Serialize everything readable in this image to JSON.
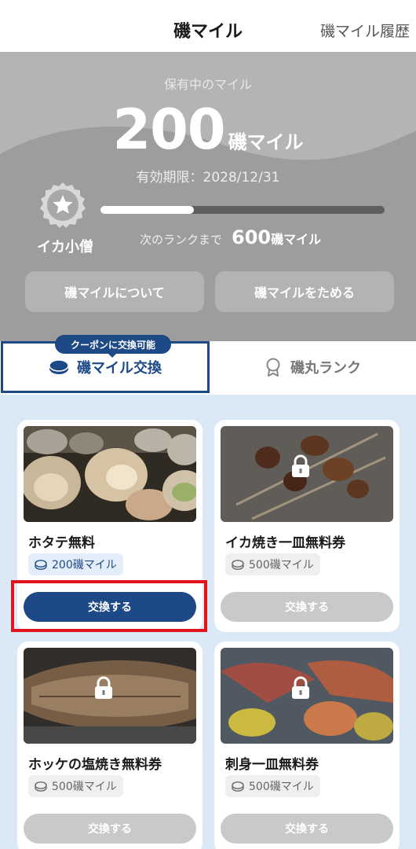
{
  "header": {
    "title": "磯マイル",
    "history_link": "磯マイル履歴"
  },
  "mileage": {
    "held_label": "保有中のマイル",
    "amount": "200",
    "unit": "磯マイル",
    "expiry": "有効期限：2028/12/31",
    "rank_name": "イカ小僧",
    "progress_fraction": 0.33,
    "next_rank_label": "次のランクまで",
    "next_rank_amount": "600",
    "next_rank_unit": "磯マイル"
  },
  "panel_buttons": {
    "about": "磯マイルについて",
    "earn": "磯マイルをためる"
  },
  "tabs": {
    "coupon_badge": "クーポンに交換可能",
    "exchange": "磯マイル交換",
    "rank": "磯丸ランク"
  },
  "items": [
    {
      "name": "ホタテ無料",
      "cost": "200磯マイル",
      "button": "交換する",
      "available": true,
      "image": "scallops-photo"
    },
    {
      "name": "イカ焼き一皿無料券",
      "cost": "500磯マイル",
      "button": "交換する",
      "available": false,
      "image": "grilled-squid-photo"
    },
    {
      "name": "ホッケの塩焼き無料券",
      "cost": "500磯マイル",
      "button": "交換する",
      "available": false,
      "image": "grilled-hokke-photo"
    },
    {
      "name": "刺身一皿無料券",
      "cost": "500磯マイル",
      "button": "交換する",
      "available": false,
      "image": "sashimi-photo"
    }
  ],
  "icons": {
    "rank_badge": "star-badge-icon",
    "exchange_tab": "coin-icon",
    "rank_tab": "ribbon-medal-icon",
    "lock": "lock-icon",
    "cost": "coin-icon"
  },
  "colors": {
    "brand": "#1d4a86",
    "highlight": "#e0151b",
    "panel": "#9b9b9b",
    "grid_bg": "#dbe9f6"
  }
}
